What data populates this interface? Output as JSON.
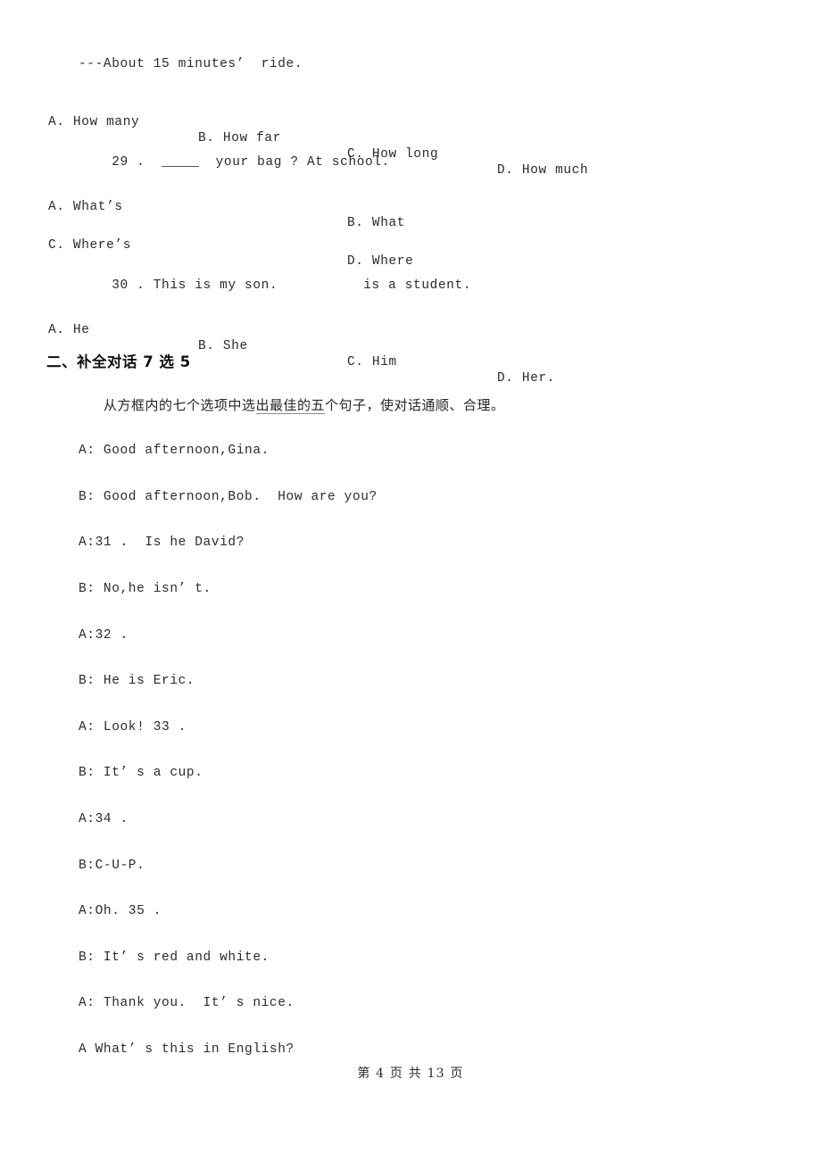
{
  "document": {
    "type": "exam-paper",
    "language": "zh-CN/en",
    "background_color": "#ffffff",
    "text_color": "#2b2b2b"
  },
  "questions": [
    {
      "id": "q28-answer-line",
      "stem": "---About 15 minutes’  ride.",
      "options": [
        "A. How many",
        "B. How far",
        "C. How long",
        "D. How much"
      ],
      "layout": "single-row"
    },
    {
      "id": "q29",
      "number": "29",
      "stem_before": "29 .  ",
      "stem_after": "  your bag ? At school.",
      "blank_style": "underline",
      "options_row1": [
        "A. What’s",
        "B. What"
      ],
      "options_row2": [
        "C. Where’s",
        "D. Where"
      ],
      "layout": "two-rows"
    },
    {
      "id": "q30",
      "number": "30",
      "stem_before": "30 . This is my son.",
      "stem_after": "is a student.",
      "blank_style": "gap",
      "options": [
        "A. He",
        "B. She",
        "C. Him",
        "D. Her."
      ],
      "layout": "single-row"
    }
  ],
  "section_two": {
    "heading": "二、补全对话 7 选 5",
    "instruction_part1": "从方框内的七个选项中选",
    "instruction_underlined": "出最佳的五",
    "instruction_part2": "个句子，使对话通顺、合理。",
    "dialogue": [
      "A: Good afternoon,Gina.",
      "B: Good afternoon,Bob.  How are you?",
      "A:31 .  Is he David?",
      "B: No,he isn’ t.",
      "A:32 .",
      "B: He is Eric.",
      "A: Look! 33 .",
      "B: It’ s a cup.",
      "A:34 .",
      "B:C-U-P.",
      "A:Oh. 35 .",
      "B: It’ s red and white.",
      "A: Thank you.  It’ s nice.",
      "A What’ s this in English?"
    ]
  },
  "footer": {
    "page_label": "第 4 页 共 13 页",
    "current_page": "4",
    "total_pages": "13"
  }
}
